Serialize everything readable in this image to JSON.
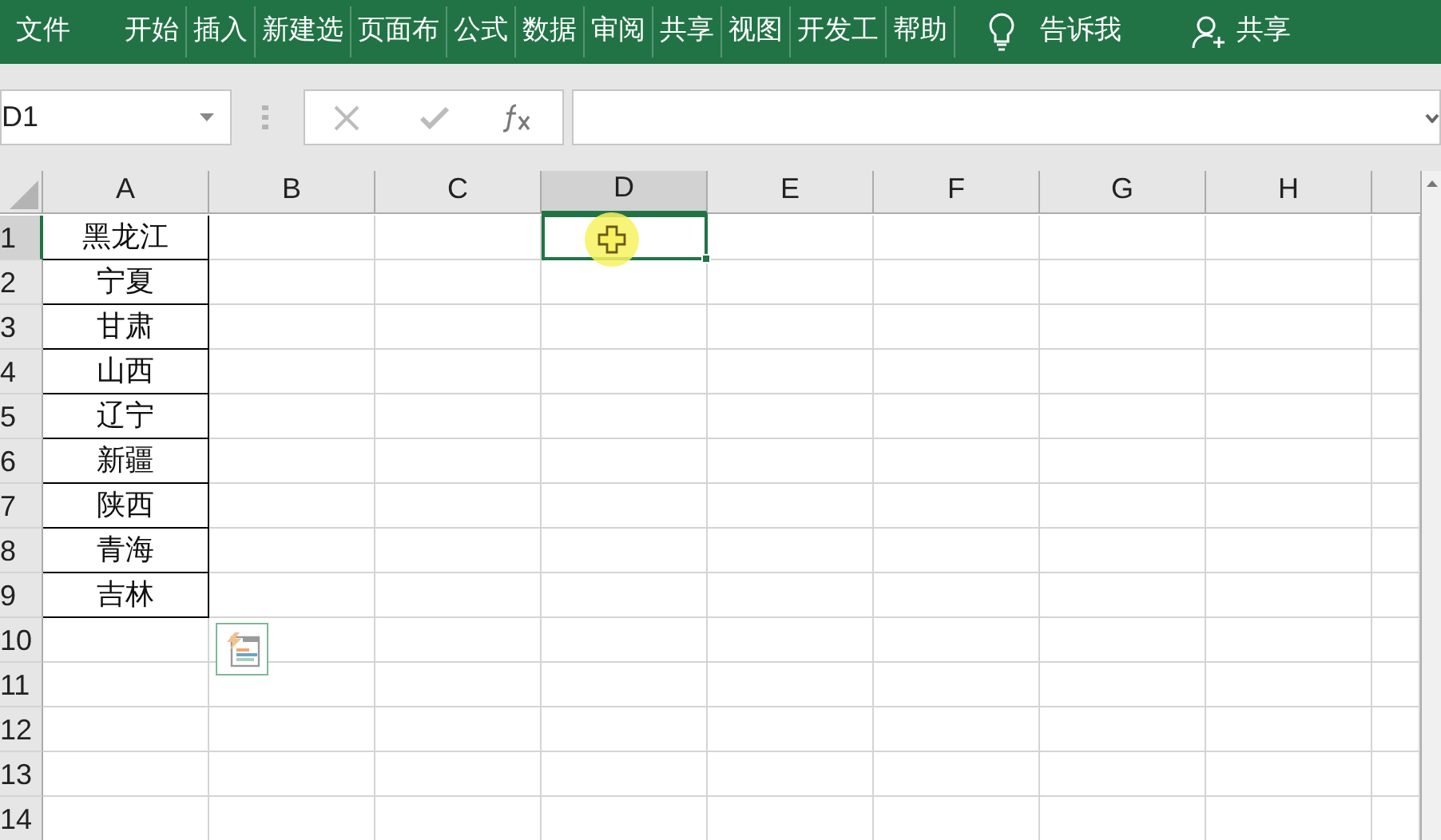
{
  "ribbon": {
    "tabs": [
      {
        "label": "文件"
      },
      {
        "label": "开始"
      },
      {
        "label": "插入"
      },
      {
        "label": "新建选"
      },
      {
        "label": "页面布"
      },
      {
        "label": "公式"
      },
      {
        "label": "数据"
      },
      {
        "label": "审阅"
      },
      {
        "label": "共享"
      },
      {
        "label": "视图"
      },
      {
        "label": "开发工"
      },
      {
        "label": "帮助"
      }
    ],
    "tell_me": "告诉我",
    "share": "共享"
  },
  "formula_bar": {
    "name_box": "D1"
  },
  "sheet": {
    "columns": [
      {
        "label": "A",
        "selected": false
      },
      {
        "label": "B",
        "selected": false
      },
      {
        "label": "C",
        "selected": false
      },
      {
        "label": "D",
        "selected": true
      },
      {
        "label": "E",
        "selected": false
      },
      {
        "label": "F",
        "selected": false
      },
      {
        "label": "G",
        "selected": false
      },
      {
        "label": "H",
        "selected": false
      }
    ],
    "rows": [
      {
        "label": "1",
        "selected": true,
        "cells": [
          "黑龙江"
        ],
        "bordered": true
      },
      {
        "label": "2",
        "selected": false,
        "cells": [
          "宁夏"
        ],
        "bordered": true
      },
      {
        "label": "3",
        "selected": false,
        "cells": [
          "甘肃"
        ],
        "bordered": true
      },
      {
        "label": "4",
        "selected": false,
        "cells": [
          "山西"
        ],
        "bordered": true
      },
      {
        "label": "5",
        "selected": false,
        "cells": [
          "辽宁"
        ],
        "bordered": true
      },
      {
        "label": "6",
        "selected": false,
        "cells": [
          "新疆"
        ],
        "bordered": true
      },
      {
        "label": "7",
        "selected": false,
        "cells": [
          "陕西"
        ],
        "bordered": true
      },
      {
        "label": "8",
        "selected": false,
        "cells": [
          "青海"
        ],
        "bordered": true
      },
      {
        "label": "9",
        "selected": false,
        "cells": [
          "吉林"
        ],
        "bordered": true
      },
      {
        "label": "10",
        "selected": false,
        "bordered": false
      },
      {
        "label": "11",
        "selected": false,
        "bordered": false
      },
      {
        "label": "12",
        "selected": false,
        "bordered": false
      },
      {
        "label": "13",
        "selected": false,
        "bordered": false
      },
      {
        "label": "14",
        "selected": false,
        "bordered": false
      }
    ]
  }
}
